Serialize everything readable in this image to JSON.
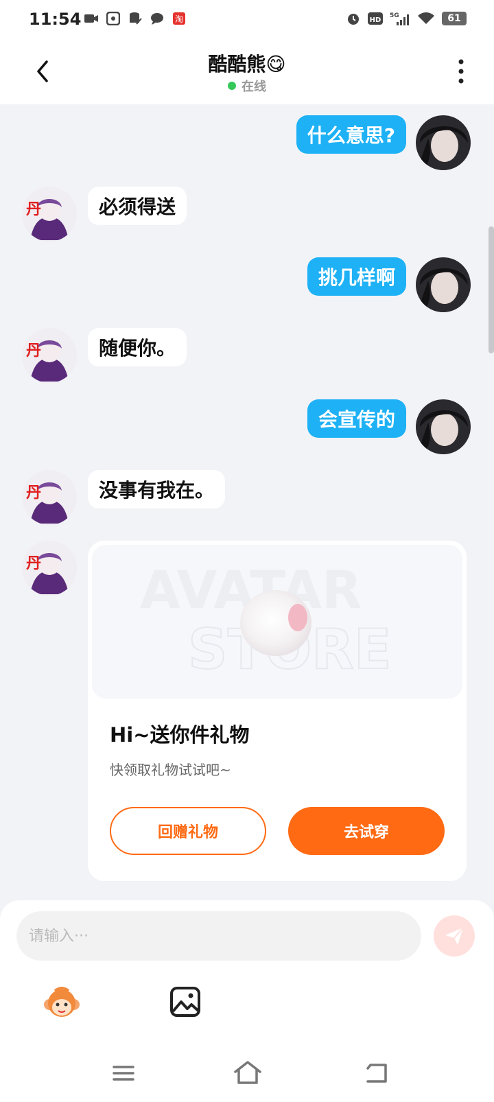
{
  "status_bar": {
    "time": "11:54",
    "battery": "61",
    "network": "5G",
    "hd": "HD"
  },
  "header": {
    "title": "酷酷熊😋",
    "online_label": "在线"
  },
  "messages": [
    {
      "side": "out",
      "text": "什么意思?"
    },
    {
      "side": "in",
      "text": "必须得送"
    },
    {
      "side": "out",
      "text": "挑几样啊"
    },
    {
      "side": "in",
      "text": "随便你。"
    },
    {
      "side": "out",
      "text": "会宣传的"
    },
    {
      "side": "in",
      "text": "没事有我在。"
    }
  ],
  "gift_card": {
    "title": "Hi~送你件礼物",
    "subtitle": "快领取礼物试试吧~",
    "return_label": "回赠礼物",
    "try_label": "去试穿",
    "watermark_line1": "AVATAR",
    "watermark_line2": "STORE"
  },
  "composer": {
    "placeholder": "请输入···"
  },
  "colors": {
    "outgoing_bubble": "#1eb1f5",
    "accent_orange": "#ff6a13",
    "online_green": "#34c759",
    "background": "#f2f3f7"
  },
  "icons": {
    "back": "chevron-left-icon",
    "more": "more-vertical-icon",
    "send": "send-icon",
    "emoji": "monkey-sticker-icon",
    "image": "image-icon"
  }
}
